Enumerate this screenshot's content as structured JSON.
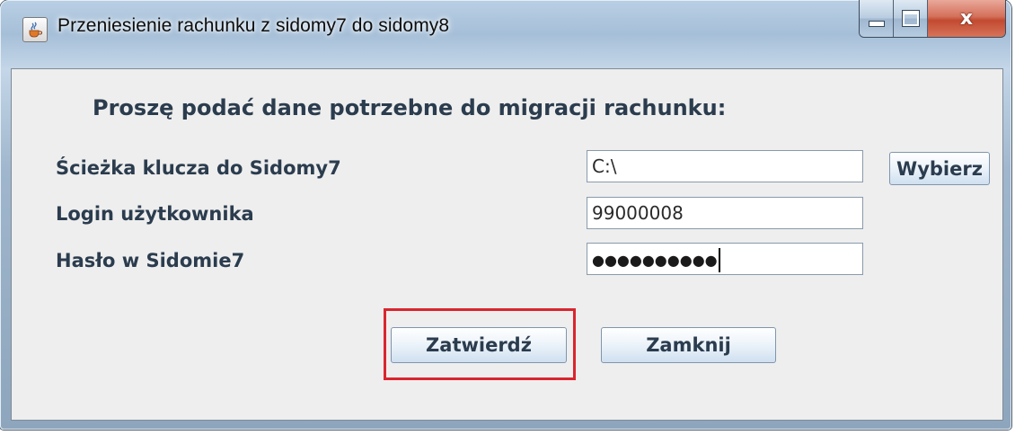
{
  "window": {
    "title": "Przeniesienie rachunku z sidomy7 do sidomy8",
    "app_icon": "java-cup-icon",
    "controls": {
      "minimize_icon": "minimize-icon",
      "maximize_icon": "maximize-icon",
      "close_icon": "close-icon",
      "close_glyph": "x"
    }
  },
  "form": {
    "header": "Proszę podać dane potrzebne do migracji rachunku:",
    "fields": [
      {
        "label": "Ścieżka klucza do Sidomy7",
        "value": "C:\\"
      },
      {
        "label": "Login użytkownika",
        "value": "99000008"
      },
      {
        "label": "Hasło w Sidomie7",
        "value": "●●●●●●●●●●"
      }
    ],
    "browse_button": "Wybierz",
    "confirm_button": "Zatwierdź",
    "close_button": "Zamknij"
  },
  "colors": {
    "label_text": "#2b3c4e",
    "highlight_border": "#d9252e",
    "panel_background": "#eeeeee"
  }
}
